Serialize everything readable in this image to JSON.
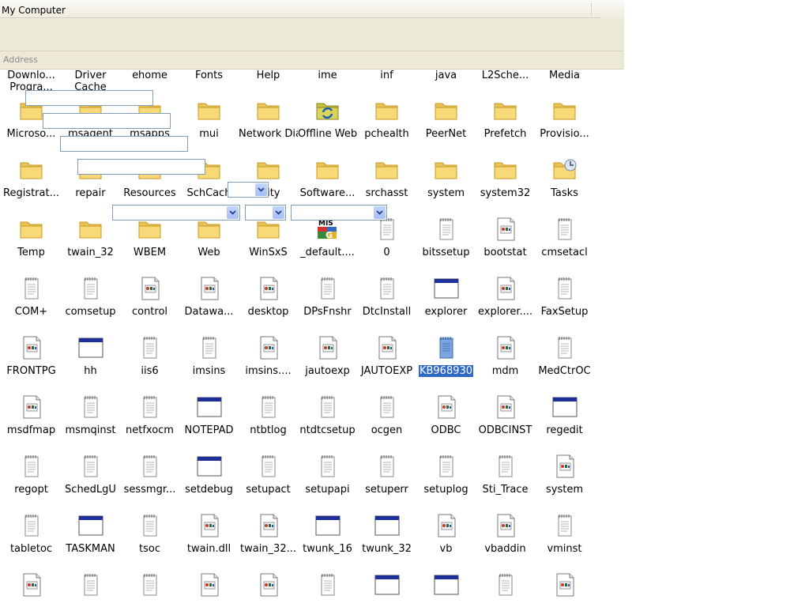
{
  "window": {
    "title": "My Computer"
  },
  "address": {
    "label": "Address"
  },
  "first_row": [
    "Downlo... Progra...",
    "Driver Cache",
    "ehome",
    "Fonts",
    "Help",
    "ime",
    "inf",
    "java",
    "L2Sche...",
    "Media"
  ],
  "items": [
    {
      "label": "Microso...",
      "icon": "folder"
    },
    {
      "label": "msagent",
      "icon": "folder"
    },
    {
      "label": "msapps",
      "icon": "folder"
    },
    {
      "label": "mui",
      "icon": "folder"
    },
    {
      "label": "Network Diagnostic",
      "icon": "folder"
    },
    {
      "label": "Offline Web...",
      "icon": "offline-folder"
    },
    {
      "label": "pchealth",
      "icon": "folder"
    },
    {
      "label": "PeerNet",
      "icon": "folder"
    },
    {
      "label": "Prefetch",
      "icon": "folder"
    },
    {
      "label": "Provisio...",
      "icon": "folder"
    },
    {
      "label": "Registrat...",
      "icon": "folder"
    },
    {
      "label": "repair",
      "icon": "folder"
    },
    {
      "label": "Resources",
      "icon": "folder"
    },
    {
      "label": "SchCach",
      "icon": "folder"
    },
    {
      "label": "urity",
      "icon": "folder"
    },
    {
      "label": "Software...",
      "icon": "folder"
    },
    {
      "label": "srchasst",
      "icon": "folder"
    },
    {
      "label": "system",
      "icon": "folder"
    },
    {
      "label": "system32",
      "icon": "folder"
    },
    {
      "label": "Tasks",
      "icon": "tasks-folder"
    },
    {
      "label": "Temp",
      "icon": "folder"
    },
    {
      "label": "twain_32",
      "icon": "folder"
    },
    {
      "label": "WBEM",
      "icon": "folder"
    },
    {
      "label": "Web",
      "icon": "folder"
    },
    {
      "label": "WinSxS",
      "icon": "folder"
    },
    {
      "label": "_default....",
      "icon": "ms-logo"
    },
    {
      "label": "0",
      "icon": "text"
    },
    {
      "label": "bitssetup",
      "icon": "text"
    },
    {
      "label": "bootstat",
      "icon": "image"
    },
    {
      "label": "cmsetacl",
      "icon": "text"
    },
    {
      "label": "COM+",
      "icon": "text"
    },
    {
      "label": "comsetup",
      "icon": "text"
    },
    {
      "label": "control",
      "icon": "image"
    },
    {
      "label": "Datawa...",
      "icon": "image"
    },
    {
      "label": "desktop",
      "icon": "image"
    },
    {
      "label": "DPsFnshr",
      "icon": "text"
    },
    {
      "label": "DtcInstall",
      "icon": "text"
    },
    {
      "label": "explorer",
      "icon": "window"
    },
    {
      "label": "explorer....",
      "icon": "image"
    },
    {
      "label": "FaxSetup",
      "icon": "text"
    },
    {
      "label": "FRONTPG",
      "icon": "image"
    },
    {
      "label": "hh",
      "icon": "window"
    },
    {
      "label": "iis6",
      "icon": "text"
    },
    {
      "label": "imsins",
      "icon": "text"
    },
    {
      "label": "imsins....",
      "icon": "image"
    },
    {
      "label": "jautoexp",
      "icon": "image"
    },
    {
      "label": "JAUTOEXP",
      "icon": "image"
    },
    {
      "label": "KB968930",
      "icon": "blue-doc",
      "selected": true
    },
    {
      "label": "mdm",
      "icon": "image"
    },
    {
      "label": "MedCtrOC",
      "icon": "text"
    },
    {
      "label": "msdfmap",
      "icon": "image"
    },
    {
      "label": "msmqinst",
      "icon": "text"
    },
    {
      "label": "netfxocm",
      "icon": "text"
    },
    {
      "label": "NOTEPAD",
      "icon": "window"
    },
    {
      "label": "ntbtlog",
      "icon": "text"
    },
    {
      "label": "ntdtcsetup",
      "icon": "text"
    },
    {
      "label": "ocgen",
      "icon": "text"
    },
    {
      "label": "ODBC",
      "icon": "image"
    },
    {
      "label": "ODBCINST",
      "icon": "image"
    },
    {
      "label": "regedit",
      "icon": "window"
    },
    {
      "label": "regopt",
      "icon": "text"
    },
    {
      "label": "SchedLgU",
      "icon": "text"
    },
    {
      "label": "sessmgr...",
      "icon": "text"
    },
    {
      "label": "setdebug",
      "icon": "window"
    },
    {
      "label": "setupact",
      "icon": "text"
    },
    {
      "label": "setupapi",
      "icon": "text"
    },
    {
      "label": "setuperr",
      "icon": "text"
    },
    {
      "label": "setuplog",
      "icon": "text"
    },
    {
      "label": "Sti_Trace",
      "icon": "text"
    },
    {
      "label": "system",
      "icon": "image"
    },
    {
      "label": "tabletoc",
      "icon": "text"
    },
    {
      "label": "TASKMAN",
      "icon": "window"
    },
    {
      "label": "tsoc",
      "icon": "text"
    },
    {
      "label": "twain.dll",
      "icon": "image"
    },
    {
      "label": "twain_32...",
      "icon": "image"
    },
    {
      "label": "twunk_16",
      "icon": "window"
    },
    {
      "label": "twunk_32",
      "icon": "window"
    },
    {
      "label": "vb",
      "icon": "image"
    },
    {
      "label": "vbaddin",
      "icon": "image"
    },
    {
      "label": "vminst",
      "icon": "text"
    },
    {
      "label": "",
      "icon": "image"
    },
    {
      "label": "",
      "icon": "text"
    },
    {
      "label": "",
      "icon": "text"
    },
    {
      "label": "",
      "icon": "image"
    },
    {
      "label": "",
      "icon": "image"
    },
    {
      "label": "",
      "icon": "text"
    },
    {
      "label": "",
      "icon": "window"
    },
    {
      "label": "",
      "icon": "window"
    },
    {
      "label": "",
      "icon": "text"
    },
    {
      "label": "",
      "icon": "image"
    }
  ]
}
